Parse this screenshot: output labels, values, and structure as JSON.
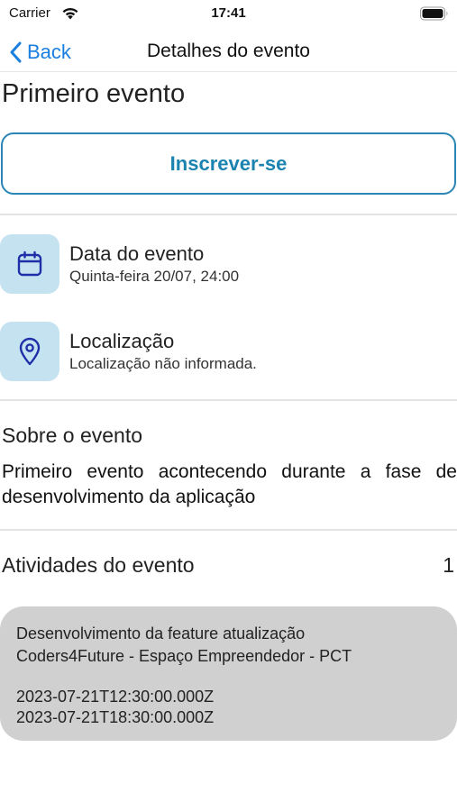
{
  "status_bar": {
    "carrier": "Carrier",
    "time": "17:41"
  },
  "nav": {
    "back_label": "Back",
    "title": "Detalhes do evento",
    "accent_color": "#1a7fe0"
  },
  "event": {
    "title": "Primeiro evento",
    "subscribe_label": "Inscrever-se"
  },
  "info": {
    "date_title": "Data do evento",
    "date_value": "Quinta-feira 20/07, 24:00",
    "location_title": "Localização",
    "location_value": "Localização não informada."
  },
  "about": {
    "heading": "Sobre o evento",
    "text": "Primeiro evento acontecendo durante a fase de desenvolvimento da aplicação"
  },
  "activities": {
    "heading": "Atividades do evento",
    "count": "1",
    "items": [
      {
        "title": "Desenvolvimento da feature atualização",
        "location": "Coders4Future - Espaço Empreendedor - PCT",
        "start": "2023-07-21T12:30:00.000Z",
        "end": "2023-07-21T18:30:00.000Z"
      }
    ]
  },
  "icons": [
    "wifi-icon",
    "battery-icon",
    "chevron-left-icon",
    "calendar-icon",
    "location-pin-icon"
  ]
}
